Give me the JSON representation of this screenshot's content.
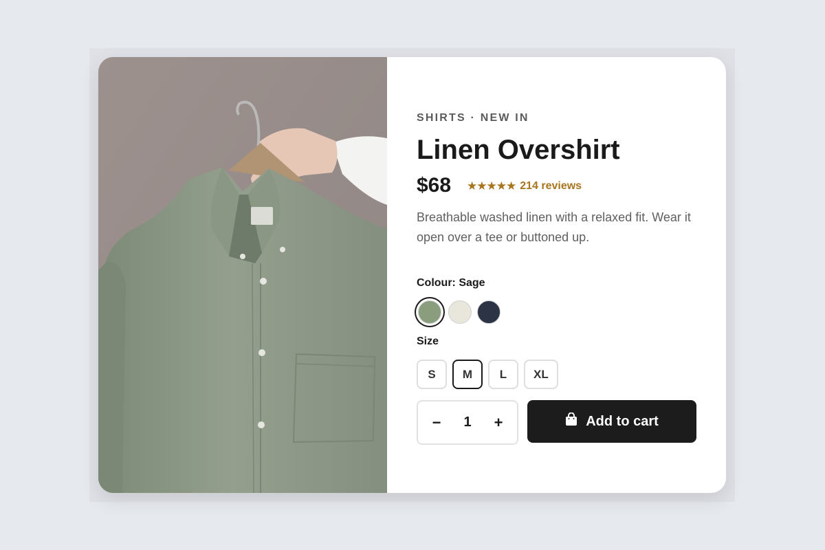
{
  "product": {
    "eyebrow": "SHIRTS · NEW IN",
    "title": "Linen Overshirt",
    "price": "$68",
    "stars": "★★★★★",
    "reviews": "214 reviews",
    "description": "Breathable washed linen with a relaxed fit. Wear it open over a tee or buttoned up."
  },
  "colour": {
    "label": "Colour: Sage",
    "options": [
      {
        "name": "Sage",
        "hex": "#8a9e7e",
        "selected": true
      },
      {
        "name": "Cream",
        "hex": "#e9e6dc",
        "selected": false
      },
      {
        "name": "Navy",
        "hex": "#2b3344",
        "selected": false
      }
    ]
  },
  "size": {
    "label": "Size",
    "options": [
      {
        "label": "S",
        "selected": false
      },
      {
        "label": "M",
        "selected": true
      },
      {
        "label": "L",
        "selected": false
      },
      {
        "label": "XL",
        "selected": false
      }
    ]
  },
  "quantity": {
    "minus": "−",
    "value": "1",
    "plus": "+"
  },
  "cart": {
    "label": "Add to cart",
    "icon": "shopping-bag-icon"
  },
  "colors": {
    "accent": "#1c1c1c",
    "rating": "#a8741e",
    "photo_bg": "#9a8f8c",
    "shirt": "#8f9c8a"
  }
}
